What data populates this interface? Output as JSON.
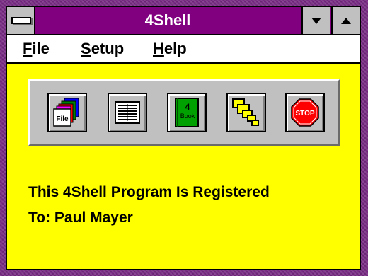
{
  "window": {
    "title": "4Shell"
  },
  "menu": {
    "file": {
      "mnemonic": "F",
      "rest": "ile"
    },
    "setup": {
      "mnemonic": "S",
      "rest": "etup"
    },
    "help": {
      "mnemonic": "H",
      "rest": "elp"
    }
  },
  "toolbar": {
    "buttons": [
      {
        "icon": "file-folders-icon",
        "label": "File"
      },
      {
        "icon": "text-document-icon",
        "label": ""
      },
      {
        "icon": "book-icon",
        "label_top": "4",
        "label_bottom": "Book"
      },
      {
        "icon": "cascade-windows-icon",
        "label": ""
      },
      {
        "icon": "stop-sign-icon",
        "label": "STOP"
      }
    ]
  },
  "registration": {
    "line1": "This 4Shell Program Is Registered",
    "line2": "To: Paul Mayer"
  },
  "colors": {
    "title_bar": "#800080",
    "client_background": "#ffff00",
    "frame": "#7a2b86"
  }
}
